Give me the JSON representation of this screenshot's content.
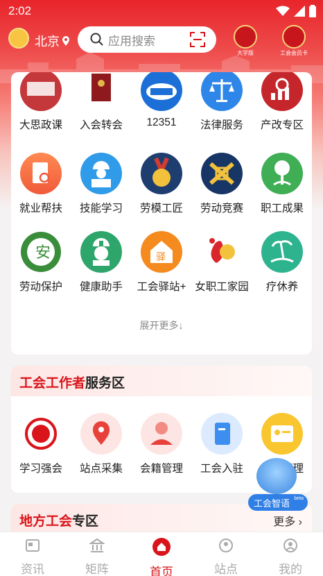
{
  "status": {
    "time": "2:02"
  },
  "header": {
    "city": "北京",
    "search_placeholder": "应用搜索",
    "badges": [
      {
        "label": "大学版",
        "icon": "university-badge-icon"
      },
      {
        "label": "工会会员卡",
        "icon": "member-card-icon"
      }
    ]
  },
  "apps": [
    {
      "label": "大思政课",
      "icon": "ideology-course-icon"
    },
    {
      "label": "入会转会",
      "icon": "membership-book-icon"
    },
    {
      "label": "12351",
      "icon": "hotline-12351-icon"
    },
    {
      "label": "法律服务",
      "icon": "scales-icon"
    },
    {
      "label": "产改专区",
      "icon": "industry-reform-icon"
    },
    {
      "label": "就业帮扶",
      "icon": "job-search-icon"
    },
    {
      "label": "技能学习",
      "icon": "worker-laptop-icon"
    },
    {
      "label": "劳模工匠",
      "icon": "medal-icon"
    },
    {
      "label": "劳动竞赛",
      "icon": "competition-icon"
    },
    {
      "label": "职工成果",
      "icon": "tree-people-icon"
    },
    {
      "label": "劳动保护",
      "icon": "safety-seal-icon"
    },
    {
      "label": "健康助手",
      "icon": "nurse-icon"
    },
    {
      "label": "工会驿站+",
      "icon": "station-house-icon"
    },
    {
      "label": "女职工家园",
      "icon": "women-home-icon"
    },
    {
      "label": "疗休养",
      "icon": "palm-beach-icon"
    }
  ],
  "expand_text": "展开更多↓",
  "worker_section": {
    "title_red": "工会工作者",
    "title_dark": "服务区",
    "items": [
      {
        "label": "学习强会",
        "icon": "study-emblem-icon"
      },
      {
        "label": "站点采集",
        "icon": "map-pin-icon"
      },
      {
        "label": "会籍管理",
        "icon": "person-star-icon"
      },
      {
        "label": "工会入驻",
        "icon": "document-icon"
      },
      {
        "label": "组织管理",
        "icon": "id-card-icon"
      }
    ]
  },
  "local_section": {
    "title_red": "地方工会",
    "title_dark": "专区",
    "more": "更多"
  },
  "ai": {
    "label": "工会智语",
    "beta": "beta"
  },
  "nav": [
    {
      "label": "资讯",
      "icon": "news-icon"
    },
    {
      "label": "矩阵",
      "icon": "building-icon"
    },
    {
      "label": "首页",
      "icon": "home-icon",
      "active": true
    },
    {
      "label": "站点",
      "icon": "station-icon"
    },
    {
      "label": "我的",
      "icon": "profile-icon"
    }
  ]
}
